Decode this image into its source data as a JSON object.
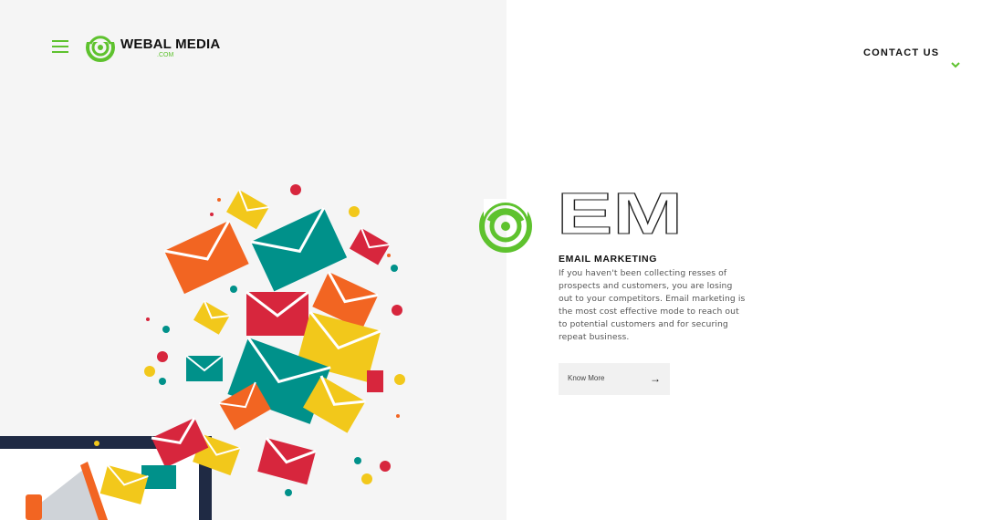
{
  "header": {
    "brand": "WEBAL MEDIA",
    "brand_suffix": ".COM",
    "contact_label": "CONTACT US"
  },
  "section": {
    "badge": "EM",
    "title": "EMAIL MARKETING",
    "description": "If you haven't been collecting resses of prospects and customers, you are losing out to your competitors. Email marketing is the most cost effective mode to reach out to potential customers and for securing repeat business.",
    "button_label": "Know More",
    "button_arrow": "→"
  },
  "colors": {
    "accent": "#5ec22e",
    "left_panel_bg": "#f5f5f5",
    "envelope_orange": "#f26522",
    "envelope_teal": "#00918a",
    "envelope_yellow": "#f2c81b",
    "envelope_red": "#d7263d",
    "monitor_navy": "#1f2a44"
  },
  "icons": [
    "menu-icon",
    "target-logo-icon",
    "chevron-down-icon",
    "arrow-right-icon",
    "megaphone-icon",
    "envelope-icon"
  ]
}
